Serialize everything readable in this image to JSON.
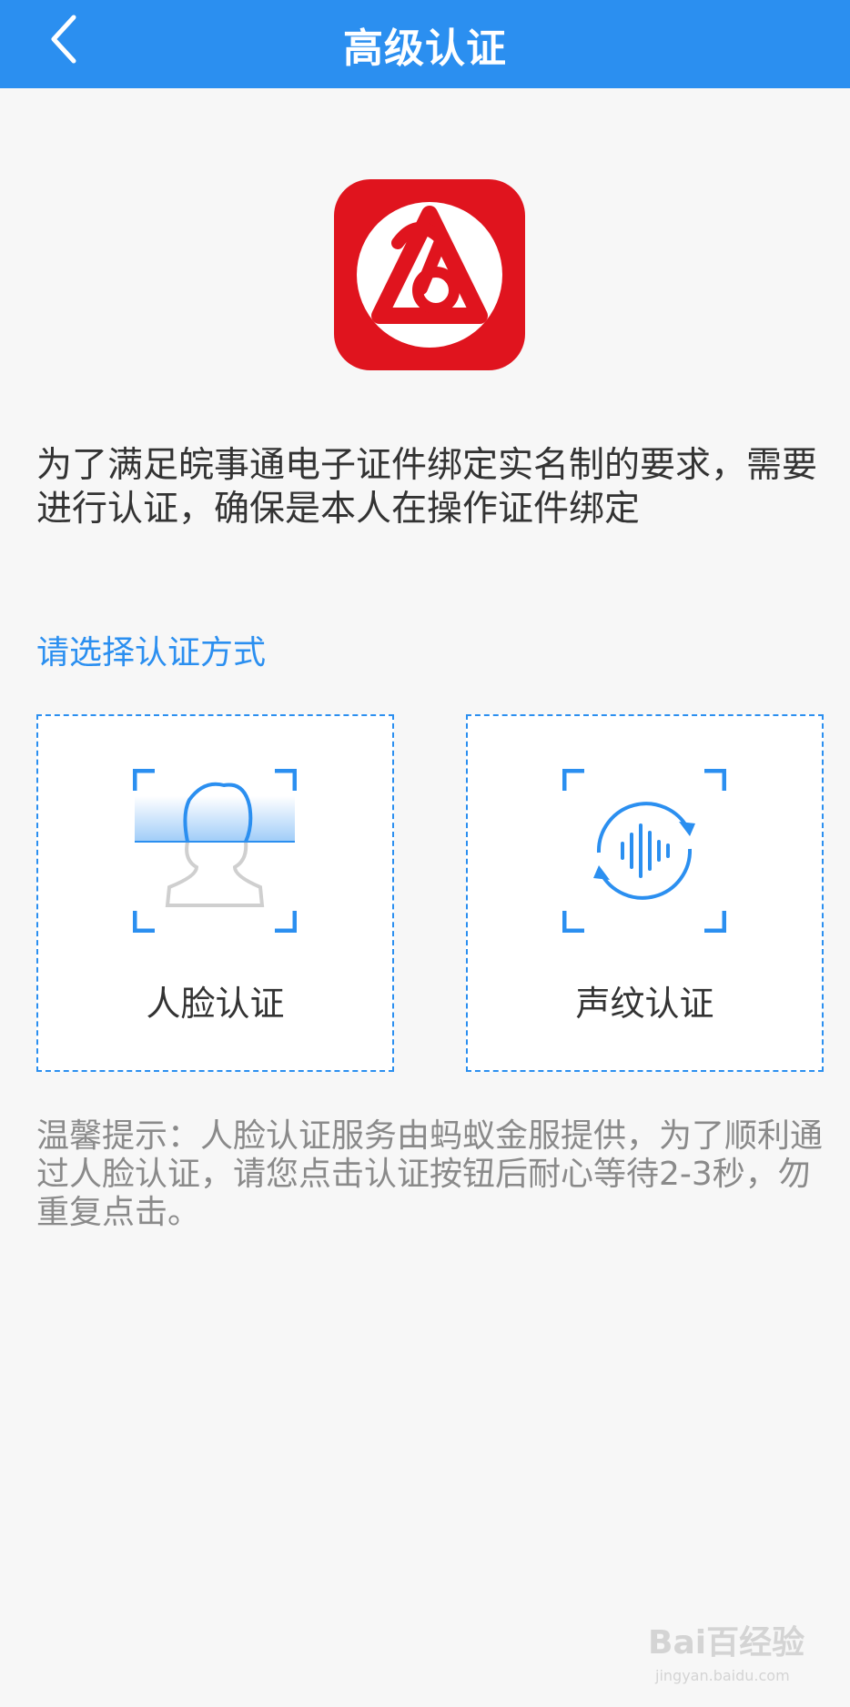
{
  "header": {
    "title": "高级认证",
    "back_icon": "chevron-left-icon",
    "background": "#2b8ff0"
  },
  "app_logo": {
    "icon": "wanshitong-app-logo",
    "color": "#e0141e"
  },
  "intro_text": "为了满足皖事通电子证件绑定实名制的要求，需要进行认证，确保是本人在操作证件绑定",
  "section_label": "请选择认证方式",
  "options": [
    {
      "label": "人脸认证",
      "icon": "face-scan-icon"
    },
    {
      "label": "声纹认证",
      "icon": "voiceprint-icon"
    }
  ],
  "tip_text": "温馨提示：人脸认证服务由蚂蚁金服提供，为了顺利通过人脸认证，请您点击认证按钮后耐心等待2-3秒，勿重复点击。",
  "watermark": {
    "main": "Bai百经验",
    "sub": "jingyan.baidu.com"
  },
  "accent_color": "#2b8ff0"
}
